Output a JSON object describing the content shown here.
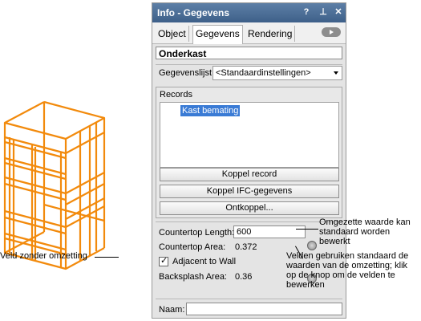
{
  "palette": {
    "title": "Info - Gegevens",
    "titlebar_icons": [
      "help-icon",
      "pin-icon",
      "close-icon"
    ],
    "help_glyph": "?",
    "pin_glyph": "⊥",
    "close_glyph": "✕",
    "tabs": [
      {
        "label": "Object",
        "active": false
      },
      {
        "label": "Gegevens",
        "active": true
      },
      {
        "label": "Rendering",
        "active": false
      }
    ],
    "object_name": "Onderkast",
    "record_list_label": "Gegevenslijst:",
    "record_list_value": "<Standaardinstellingen>",
    "records_label": "Records",
    "records": [
      "Kast bemating"
    ],
    "buttons": {
      "link_record": "Koppel record",
      "link_ifc": "Koppel IFC-gegevens",
      "unlink": "Ontkoppel..."
    },
    "fields": {
      "countertop_length_label": "Countertop Length:",
      "countertop_length_value": "600",
      "countertop_area_label": "Countertop Area:",
      "countertop_area_value": "0.372",
      "adjacent_label": "Adjacent to Wall",
      "adjacent_checked": true,
      "backsplash_label": "Backsplash Area:",
      "backsplash_value": "0.36"
    },
    "name_label": "Naam:",
    "name_value": ""
  },
  "annotations": {
    "left": "Veld zonder omzetting",
    "right_top": "Omgezette waarde kan standaard worden bewerkt",
    "right_bottom": "Velden gebruiken standaard de waarden van de omzetting; klik op de knop om de velden te bewerken"
  },
  "colors": {
    "cabinet": "#f28a0c",
    "titlebar": "#4a6d97",
    "selection": "#3a7bd5"
  }
}
